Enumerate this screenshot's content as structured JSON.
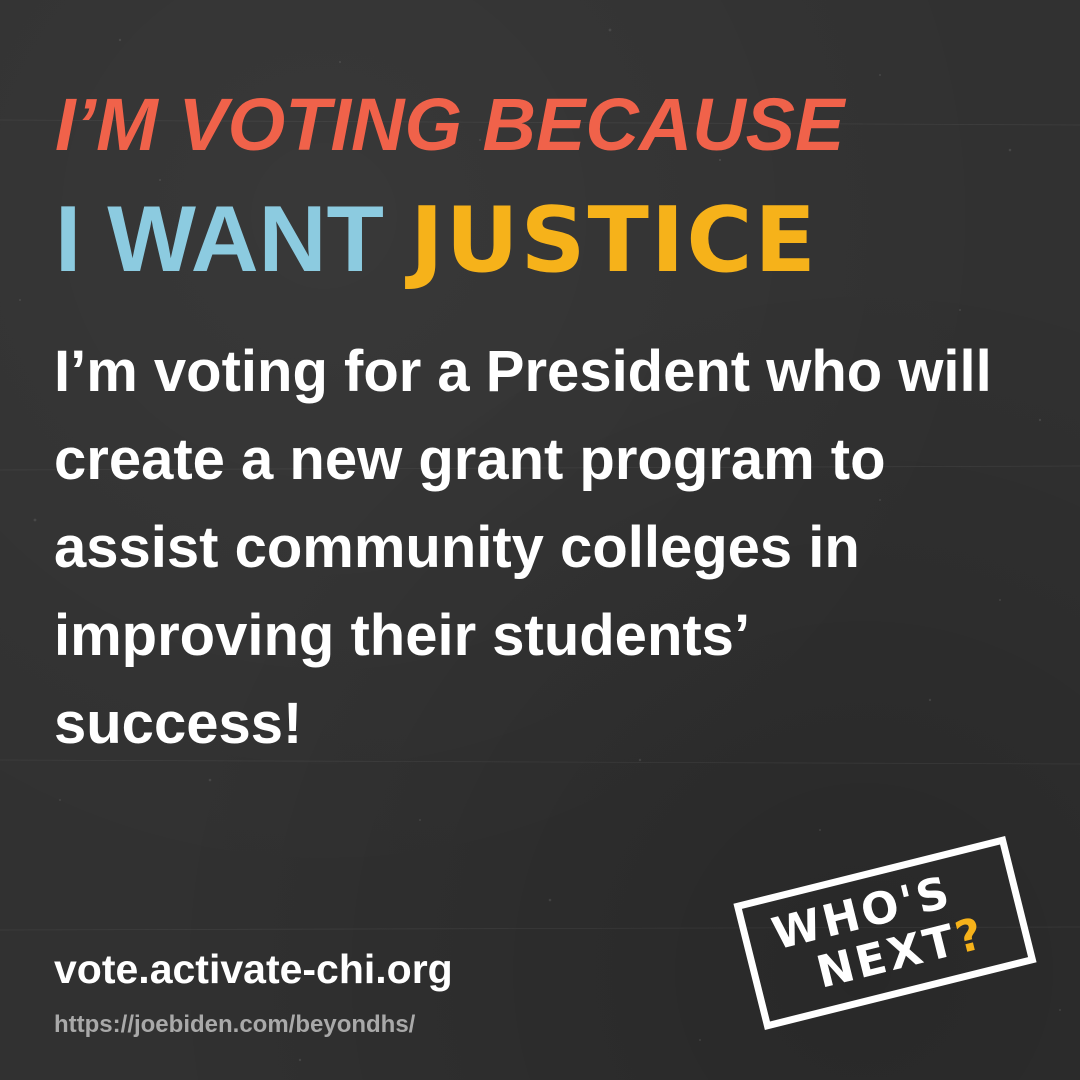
{
  "colors": {
    "background": "#313131",
    "coral": "#f0624a",
    "light_blue": "#8ccbe0",
    "gold": "#f6b21a",
    "white": "#ffffff",
    "gray_text": "#a9a9a9"
  },
  "headline": {
    "line1": "I’M VOTING BECAUSE",
    "line2_part1": "I WANT",
    "line2_part2": "JUSTICE"
  },
  "body": {
    "line1": "I’m voting for a President who will",
    "line2": "create a new grant program to",
    "line3": "assist community colleges in",
    "line4": "improving their students’",
    "line5": "success!"
  },
  "footer": {
    "primary_url": "vote.activate-chi.org",
    "source_url": "https://joebiden.com/beyondhs/"
  },
  "stamp": {
    "line1": "WHO'S",
    "line2_text": "NEXT",
    "line2_mark": "?"
  }
}
